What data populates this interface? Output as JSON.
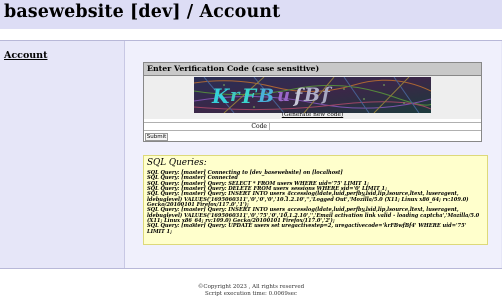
{
  "header": {
    "title": "basewebsite [dev] / Account"
  },
  "sidebar": {
    "link_label": "Account"
  },
  "verification": {
    "title": "Enter Verification Code (case sensitive)",
    "captcha_text": "KrFBufBf",
    "generate_link": "(Generate new code)",
    "code_label": "Code",
    "code_value": "",
    "submit_label": "Submit"
  },
  "sql": {
    "title": "SQL Queries:",
    "lines": [
      "SQL Query: [master] Connecting to [dev_basewebsite] on [localhost]",
      "SQL Query: [master] Connected",
      "SQL Query: [master] Query: SELECT * FROM users WHERE uid='75' LIMIT 1;",
      "SQL Query: [master] Query: DELETE FROM users_sessions WHERE sid='0' LIMIT 1;",
      "SQL Query: [master] Query: INSERT INTO users_accesslog(ldate,luid,perfby,lsid,lip,lsource,ltext, luseragent, ldebuglevel) VALUES('1695060311','0','0','0','10.1.2.10','','Logged Out','Mozilla/5.0 (X11; Linux x86_64; rv:109.0) Gecko/20100101 Firefox/117.0','1');",
      "SQL Query: [master] Query: INSERT INTO users_accesslog(ldate,luid,perfby,lsid,lip,lsource,ltext, luseragent, ldebuglevel) VALUES('1695060311','0','75','0','10.1.2.10','','Email activation link valid - loading captcha','Mozilla/5.0 (X11; Linux x86_64; rv:109.0) Gecko/20100101 Firefox/117.0','2');",
      "SQL Query: [master] Query: UPDATE users set uregactivestep=2, uregactivecode='krFBwfBf4' WHERE uid='75' LIMIT 1;"
    ]
  },
  "footer": {
    "copyright": "©Copyright 2023 , All rights reserved",
    "exec_time": "Script execution time: 0.0069sec"
  },
  "colors": {
    "header_bg": "#ddddf5",
    "content_bg": "#f0f0fc",
    "sql_bg": "#ffffcc",
    "captcha_bg": "#1b2036"
  }
}
